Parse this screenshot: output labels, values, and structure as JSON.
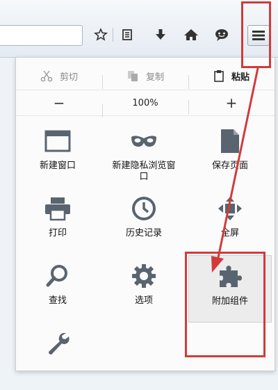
{
  "toolbar": {
    "icons": [
      "star-icon",
      "bookmarks-list-icon",
      "download-icon",
      "home-icon",
      "chat-icon",
      "hamburger-menu-icon"
    ]
  },
  "menu": {
    "edit": {
      "cut": "剪切",
      "copy": "复制",
      "paste": "粘贴"
    },
    "zoom": {
      "minus": "−",
      "level": "100%",
      "plus": "+"
    },
    "tiles": {
      "new_window": "新建窗口",
      "private_window": "新建隐私浏览窗口",
      "save_page": "保存页面",
      "print": "打印",
      "history": "历史记录",
      "fullscreen": "全屏",
      "find": "查找",
      "options": "选项",
      "addons": "附加组件"
    }
  },
  "colors": {
    "highlight": "#d23a3a",
    "icon": "#5a6470",
    "active_tile": "#ececec"
  }
}
